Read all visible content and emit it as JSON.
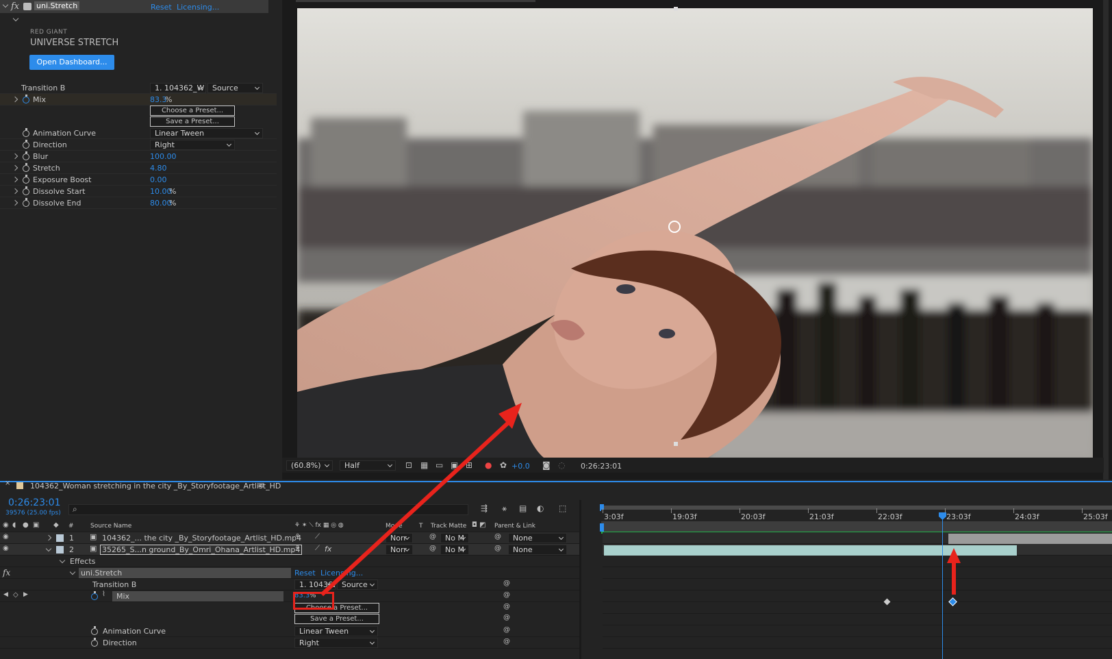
{
  "effect_controls": {
    "fx_label": "fx",
    "effect_name": "uni.Stretch",
    "reset": "Reset",
    "licensing": "Licensing...",
    "brand_line1": "RED GIANT",
    "brand_line2": "UNIVERSE STRETCH",
    "open_dashboard": "Open Dashboard...",
    "transition_b": {
      "label": "Transition B",
      "layer": "1. 104362_W",
      "source": "Source"
    },
    "mix": {
      "label": "Mix",
      "value": "83.3",
      "unit": "%"
    },
    "choose_preset": "Choose a Preset...",
    "save_preset": "Save a Preset...",
    "animation_curve": {
      "label": "Animation Curve",
      "value": "Linear Tween"
    },
    "direction": {
      "label": "Direction",
      "value": "Right"
    },
    "blur": {
      "label": "Blur",
      "value": "100.00"
    },
    "stretch": {
      "label": "Stretch",
      "value": "4.80"
    },
    "exposure_boost": {
      "label": "Exposure Boost",
      "value": "0.00"
    },
    "dissolve_start": {
      "label": "Dissolve Start",
      "value": "10.00",
      "unit": "%"
    },
    "dissolve_end": {
      "label": "Dissolve End",
      "value": "80.00",
      "unit": "%"
    }
  },
  "viewer": {
    "zoom": "(60.8%)",
    "resolution": "Half",
    "exposure": "+0.0",
    "timecode": "0:26:23:01"
  },
  "timeline": {
    "comp_name": "104362_Woman stretching in the city _By_Storyfootage_Artlist_HD",
    "timecode": "0:26:23:01",
    "frames": "39576 (25.00 fps)",
    "headers": {
      "num": "#",
      "source": "Source Name",
      "mode": "Mode",
      "t": "T",
      "track_matte": "Track Matte",
      "parent": "Parent & Link"
    },
    "layers": [
      {
        "num": "1",
        "name": "104362_... the city _By_Storyfootage_Artlist_HD.mp4",
        "mode": "Norr",
        "matte": "No M",
        "parent": "None"
      },
      {
        "num": "2",
        "name": "35265_S...n ground_By_Omri_Ohana_Artlist_HD.mp4",
        "mode": "Norr",
        "matte": "No M",
        "parent": "None"
      }
    ],
    "effects_label": "Effects",
    "fx_label": "fx",
    "effect_name": "uni.Stretch",
    "reset": "Reset",
    "licensing": "Licensing...",
    "transition_b": {
      "label": "Transition B",
      "layer": "1. 104362",
      "source": "Source"
    },
    "mix": {
      "label": "Mix",
      "value": "83.3",
      "unit": "%"
    },
    "choose_preset": "Choose a Preset...",
    "save_preset": "Save a Preset...",
    "animation_curve": {
      "label": "Animation Curve",
      "value": "Linear Tween"
    },
    "direction": {
      "label": "Direction",
      "value": "Right"
    },
    "ruler": [
      "3:03f",
      "19:03f",
      "20:03f",
      "21:03f",
      "22:03f",
      "23:03f",
      "24:03f",
      "25:03f"
    ]
  },
  "colors": {
    "accent": "#2d8ceb",
    "annotation": "#e8231c",
    "green_bar": "#20b24a",
    "clip_teal": "#a8d0cc"
  }
}
